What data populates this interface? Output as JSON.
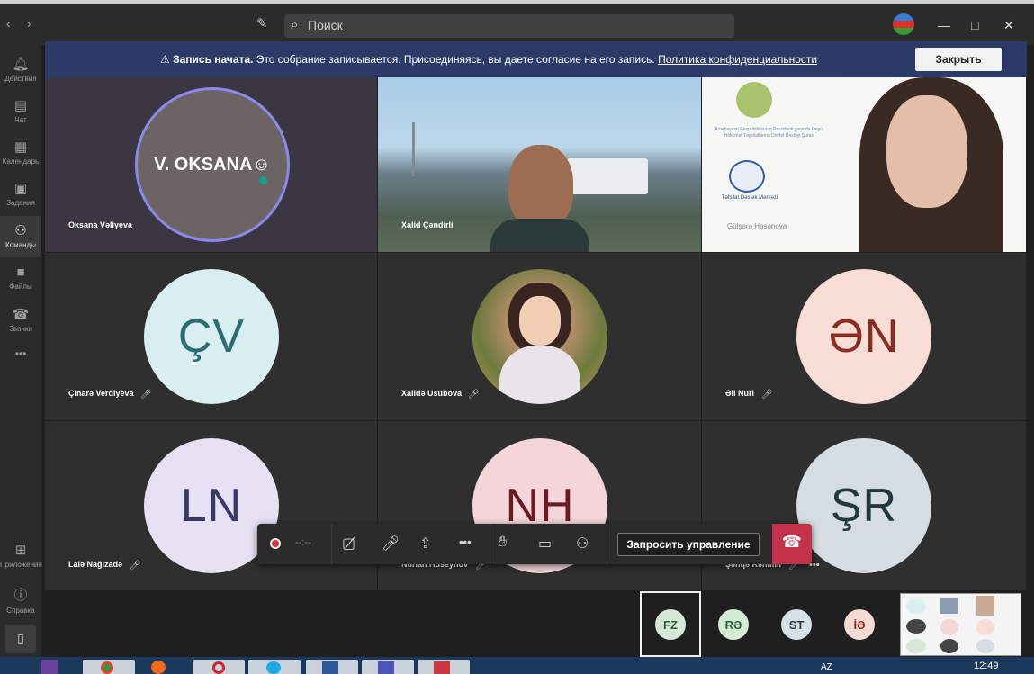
{
  "titlebar": {
    "back_icon": "chevron-left-icon",
    "forward_icon": "chevron-right-icon",
    "search_placeholder": "Поиск",
    "window_controls": [
      "minimize-icon",
      "maximize-icon",
      "close-icon"
    ]
  },
  "sidebar": {
    "items": [
      {
        "label": "Действия",
        "icon": "bell-icon"
      },
      {
        "label": "Чат",
        "icon": "chat-icon"
      },
      {
        "label": "Календарь",
        "icon": "calendar-icon"
      },
      {
        "label": "Задания",
        "icon": "briefcase-icon"
      },
      {
        "label": "Команды",
        "icon": "teams-icon",
        "active": true
      },
      {
        "label": "Файлы",
        "icon": "file-icon"
      },
      {
        "label": "Звонки",
        "icon": "phone-icon"
      },
      {
        "label": "•••",
        "icon": "more-icon"
      }
    ],
    "bottom_items": [
      {
        "label": "Приложения",
        "icon": "apps-icon"
      },
      {
        "label": "Справка",
        "icon": "help-icon"
      }
    ]
  },
  "banner": {
    "title": "Запись начата.",
    "text": "Это собрание записывается. Присоединяясь, вы даете согласие на его запись.",
    "link": "Политика конфиденциальности",
    "close_label": "Закрыть"
  },
  "participants": [
    {
      "name": "Oksana Vəliyeva",
      "avatar_text": "V. OKSANA☺",
      "type": "photo-avatar",
      "speaking": true
    },
    {
      "name": "Xalid Çəndirli",
      "type": "video"
    },
    {
      "name": "",
      "type": "video",
      "overlay_text": [
        "Gülşərə Həsənova",
        "Azərbaycan Respublikasının Prezidenti yanında Qeyri-Hökumət Təşkilatlarına Dövlət Dəstəyi Şurası",
        "Təfsilat Dəstək Mərkəzi"
      ]
    },
    {
      "name": "Çinarə Verdiyeva",
      "initials": "ÇV",
      "muted": true,
      "bg": "#d8eef0",
      "fg": "#2c6d74"
    },
    {
      "name": "Xalidə Usubova",
      "type": "photo",
      "muted": true
    },
    {
      "name": "Əli Nuri",
      "initials": "ƏN",
      "muted": true,
      "bg": "#f8dcd6",
      "fg": "#8a2d20"
    },
    {
      "name": "Lalə Nağızadə",
      "initials": "LN",
      "muted": true,
      "bg": "#e5e1f3",
      "fg": "#3b3866"
    },
    {
      "name": "Nurlan Hüseynov",
      "initials": "NH",
      "muted": true,
      "bg": "#f3d5da",
      "fg": "#6c1a22"
    },
    {
      "name": "Şəhqə Rəhimli",
      "initials": "ŞR",
      "muted": true,
      "bg": "#d5dde2",
      "fg": "#23373f"
    }
  ],
  "toolbar": {
    "record_icon": "record-icon",
    "timer": "--:--",
    "camera_icon": "camera-off-icon",
    "mic_icon": "mic-off-icon",
    "share_icon": "share-screen-icon",
    "more": "•••",
    "raise_hand_icon": "raise-hand-icon",
    "chat_icon": "chat-icon",
    "participants_icon": "participants-icon",
    "control_label": "Запросить управление",
    "hangup_icon": "hangup-icon"
  },
  "overflow_participants": [
    {
      "initials": "FZ",
      "selected": true
    },
    {
      "initials": "RƏ"
    },
    {
      "initials": "ST"
    },
    {
      "initials": "İƏ"
    }
  ],
  "taskbar": {
    "language": "AZ",
    "time": "12:49"
  }
}
